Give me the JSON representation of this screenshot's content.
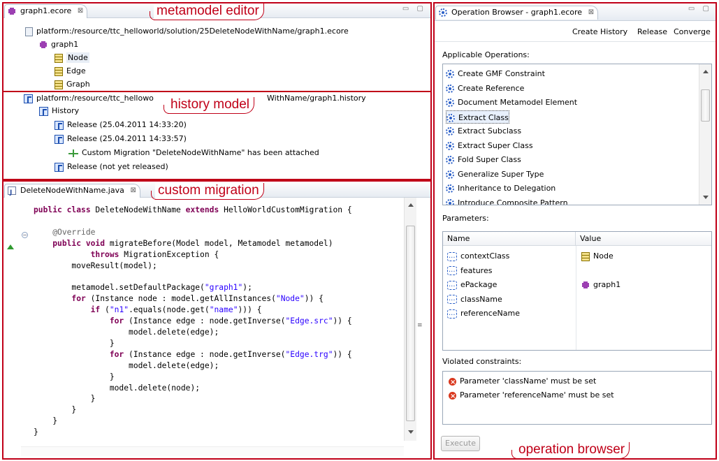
{
  "editor": {
    "tab_label": "graph1.ecore",
    "resource": "platform:/resource/ttc_helloworld/solution/25DeleteNodeWithName/graph1.ecore",
    "package": "graph1",
    "classes": [
      "Node",
      "Edge",
      "Graph"
    ],
    "callout": "metamodel editor"
  },
  "history": {
    "resource": "platform:/resource/ttc_hellowo",
    "resource_tail": "WithName/graph1.history",
    "root": "History",
    "items": [
      "Release (25.04.2011 14:33:20)",
      "Release  (25.04.2011 14:33:57)",
      "Custom Migration \"DeleteNodeWithName\" has been attached",
      "Release (not yet released)"
    ],
    "callout": "history model"
  },
  "migration": {
    "tab_label": "DeleteNodeWithName.java",
    "callout": "custom migration"
  },
  "browser": {
    "tab_label": "Operation Browser - graph1.ecore",
    "toolbar": [
      "Create History",
      "Release",
      "Converge"
    ],
    "applicable_label": "Applicable Operations:",
    "operations": [
      "Create GMF Constraint",
      "Create Reference",
      "Document Metamodel Element",
      "Extract Class",
      "Extract Subclass",
      "Extract Super Class",
      "Fold Super Class",
      "Generalize Super Type",
      "Inheritance to Delegation",
      "Introduce Composite Pattern"
    ],
    "selected_operation": "Extract Class",
    "parameters_label": "Parameters:",
    "param_columns": [
      "Name",
      "Value"
    ],
    "params": [
      {
        "name": "contextClass",
        "value": "Node"
      },
      {
        "name": "features",
        "value": ""
      },
      {
        "name": "ePackage",
        "value": "graph1"
      },
      {
        "name": "className",
        "value": ""
      },
      {
        "name": "referenceName",
        "value": ""
      }
    ],
    "violated_label": "Violated constraints:",
    "violations": [
      "Parameter 'className' must be set",
      "Parameter 'referenceName' must be set"
    ],
    "execute_label": "Execute",
    "callout": "operation browser"
  },
  "colors": {
    "callout_red": "#c00018",
    "keyword": "#7f0055",
    "string": "#2a00ff",
    "annotation": "#646464"
  }
}
